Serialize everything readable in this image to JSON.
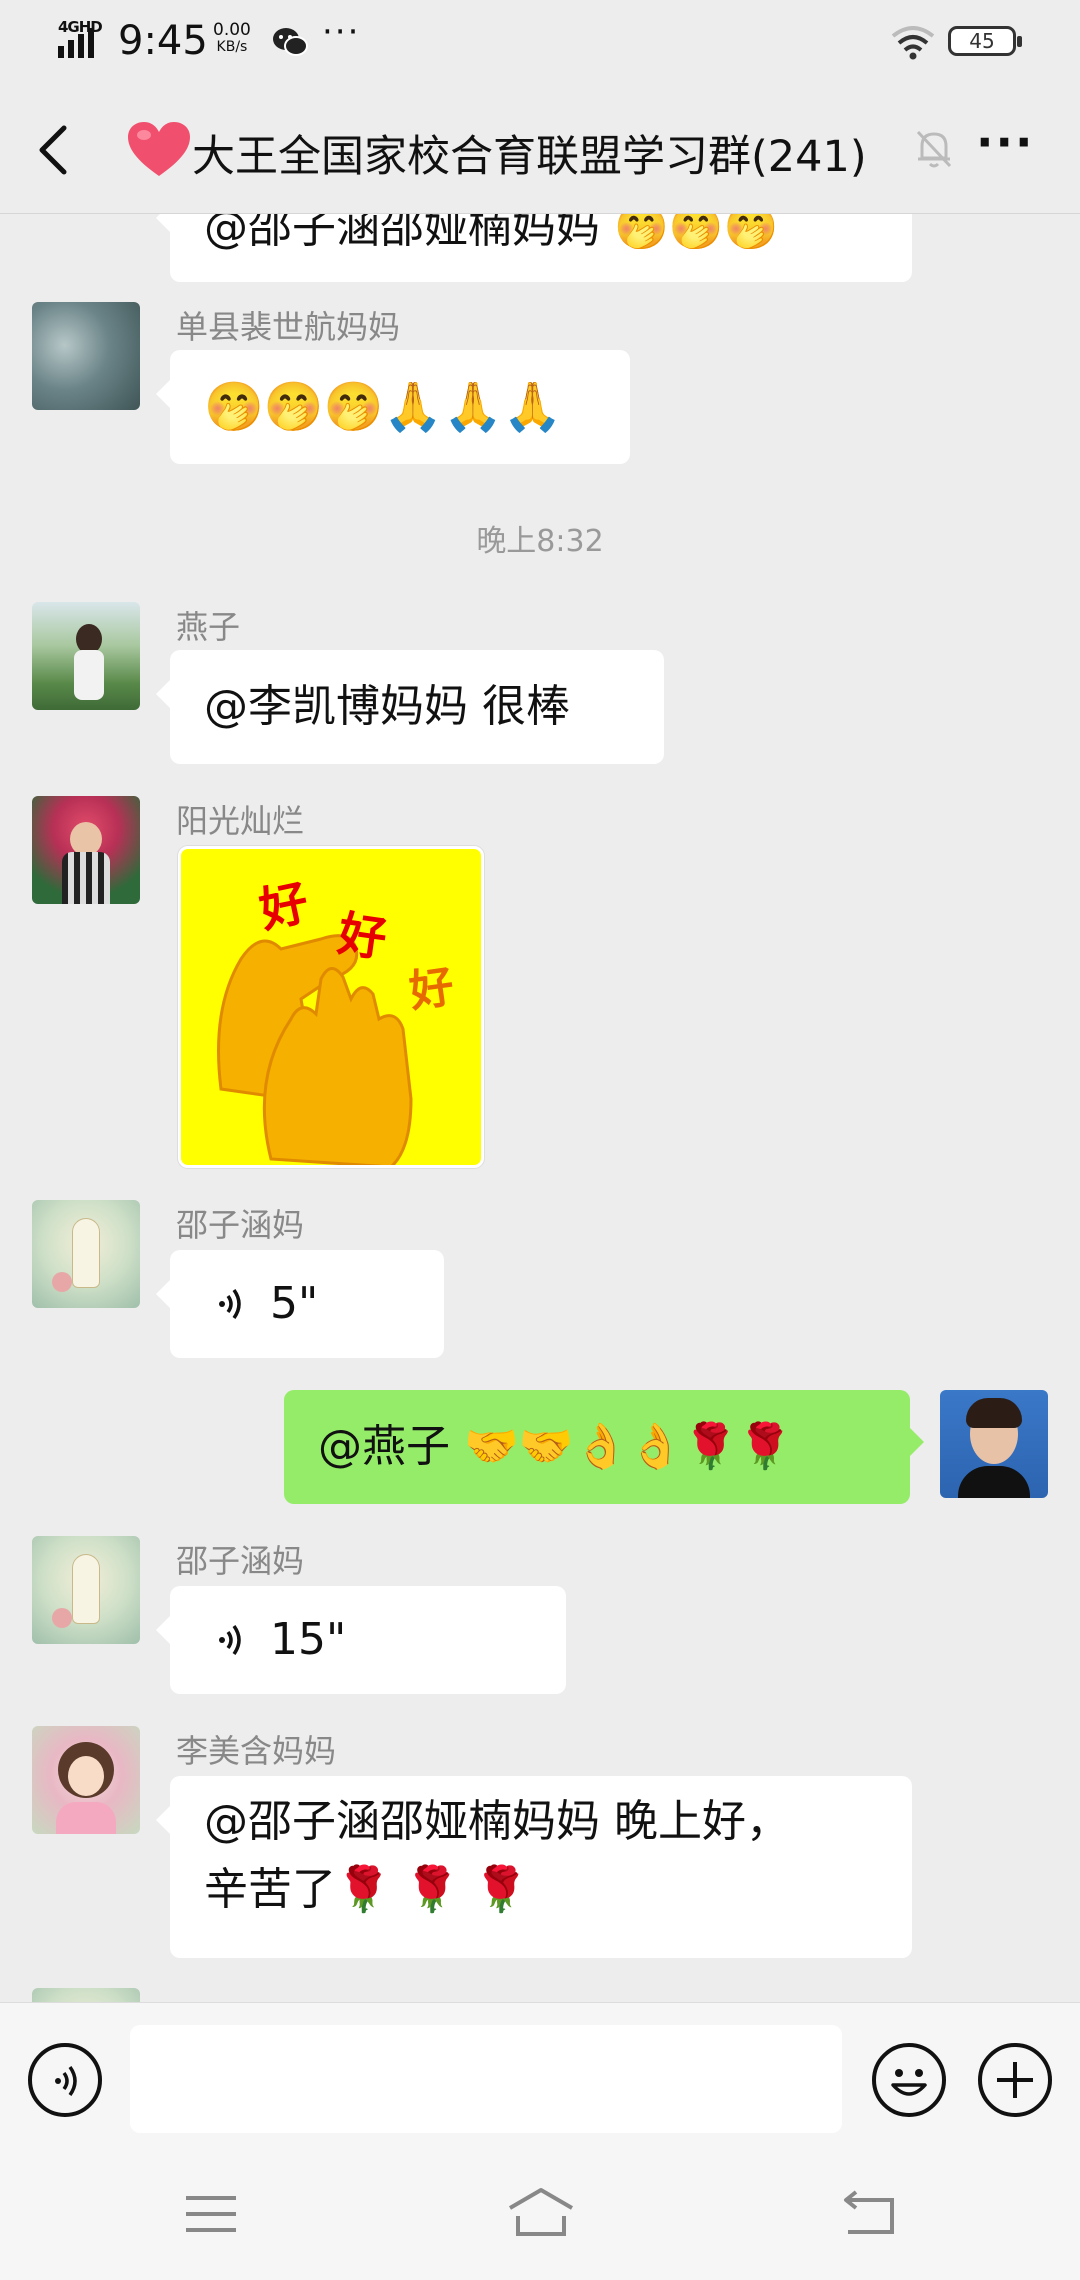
{
  "status_bar": {
    "network": "4GHD",
    "time": "9:45",
    "speed_value": "0.00",
    "speed_unit": "KB/s",
    "more": "···",
    "battery": "45"
  },
  "header": {
    "title": "大王全国家校合育联盟学习群(241)",
    "back_icon": "chevron-left",
    "mute_icon": "bell-off",
    "more_label": "···"
  },
  "messages": [
    {
      "type": "text",
      "side": "left",
      "text": "@邵子涵邵娅楠妈妈 🤭🤭🤭"
    },
    {
      "type": "text",
      "side": "left",
      "sender": "单县裴世航妈妈",
      "text": "🤭🤭🤭🙏🙏🙏"
    },
    {
      "type": "time",
      "text": "晚上8:32"
    },
    {
      "type": "text",
      "side": "left",
      "sender": "燕子",
      "text": "@李凯博妈妈  很棒"
    },
    {
      "type": "sticker",
      "side": "left",
      "sender": "阳光灿烂",
      "sticker_text": [
        "好",
        "好",
        "好"
      ]
    },
    {
      "type": "voice",
      "side": "left",
      "sender": "邵子涵妈",
      "duration": "5\""
    },
    {
      "type": "text",
      "side": "right",
      "text": "@燕子  🤝🤝👌👌🌹🌹"
    },
    {
      "type": "voice",
      "side": "left",
      "sender": "邵子涵妈",
      "duration": "15\""
    },
    {
      "type": "text",
      "side": "left",
      "sender": "李美含妈妈",
      "text_line1": "@邵子涵邵娅楠妈妈  晚上好，",
      "text_line2": "辛苦了🌹 🌹 🌹"
    }
  ],
  "input_bar": {
    "placeholder": ""
  },
  "colors": {
    "background": "#ededed",
    "bubble_self": "#95ec69",
    "bubble_other": "#ffffff",
    "sticker_bg": "#ffff00",
    "sticker_text": "#e60000"
  }
}
